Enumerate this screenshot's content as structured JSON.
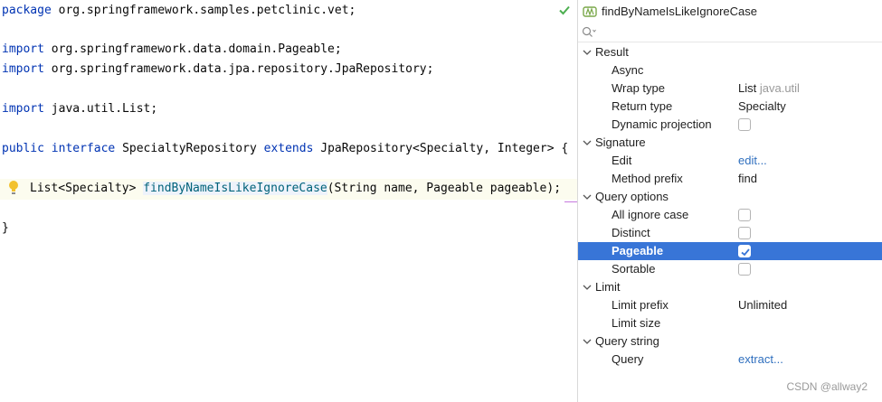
{
  "editor": {
    "lines": {
      "l1": {
        "kw": "package",
        "text": " org.springframework.samples.petclinic.vet;"
      },
      "l2": {
        "kw": "import",
        "text": " org.springframework.data.domain.Pageable;"
      },
      "l3": {
        "kw": "import",
        "text": " org.springframework.data.jpa.repository.JpaRepository;"
      },
      "l4": {
        "kw": "import",
        "text": " java.util.List;"
      },
      "l5": {
        "kw1": "public",
        "kw2": "interface",
        "mid": " SpecialtyRepository ",
        "kw3": "extends",
        "tail": " JpaRepository<Specialty, Integer> {"
      },
      "l6": {
        "pre": "List<Specialty> ",
        "method": "findByNameIsLikeIgnoreCase",
        "post": "(String name, Pageable pageable);"
      },
      "l7": {
        "text": "}"
      }
    }
  },
  "panel": {
    "title": "findByNameIsLikeIgnoreCase",
    "search_placeholder": "",
    "sections": {
      "result": {
        "label": "Result",
        "async": "Async",
        "wrap_type": "Wrap type",
        "wrap_type_value": "List",
        "wrap_type_pkg": "java.util",
        "return_type": "Return type",
        "return_type_value": "Specialty",
        "dynamic_projection": "Dynamic projection",
        "dynamic_projection_checked": false
      },
      "signature": {
        "label": "Signature",
        "edit": "Edit",
        "edit_link": "edit...",
        "method_prefix": "Method prefix",
        "method_prefix_value": "find"
      },
      "query_options": {
        "label": "Query options",
        "all_ignore_case": "All ignore case",
        "all_ignore_case_checked": false,
        "distinct": "Distinct",
        "distinct_checked": false,
        "pageable": "Pageable",
        "pageable_checked": true,
        "sortable": "Sortable",
        "sortable_checked": false
      },
      "limit": {
        "label": "Limit",
        "limit_prefix": "Limit prefix",
        "limit_prefix_value": "Unlimited",
        "limit_size": "Limit size"
      },
      "query_string": {
        "label": "Query string",
        "query": "Query",
        "query_link": "extract..."
      }
    }
  },
  "watermark": "CSDN @allway2",
  "colors": {
    "selection": "#3875d7",
    "keyword": "#0033b3",
    "method": "#00627a",
    "link": "#2f6fbe",
    "highlight_line": "#fcfcef"
  },
  "icons": {
    "check": "inspection-ok-icon",
    "bulb": "intention-bulb-icon",
    "method": "method-icon",
    "search": "search-icon",
    "chevron": "chevron-down-icon"
  }
}
